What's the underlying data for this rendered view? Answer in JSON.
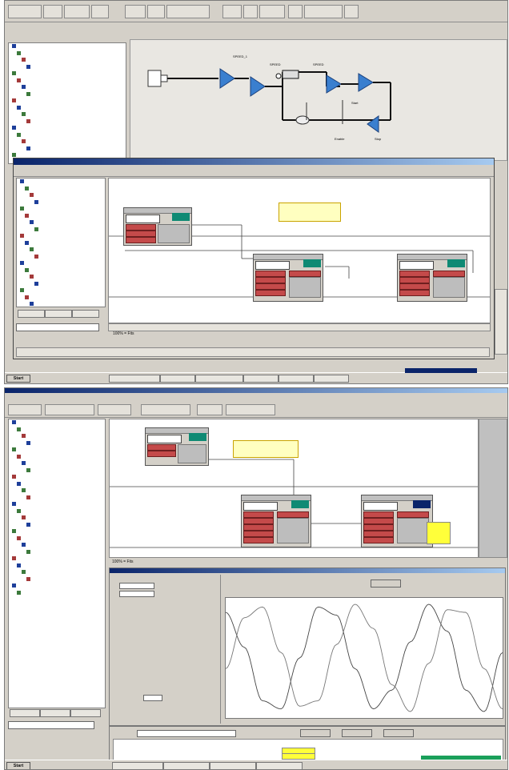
{
  "top": {
    "tree_items": [
      "",
      "",
      "",
      "",
      "",
      "",
      "",
      "",
      "",
      "",
      "",
      "",
      "",
      "",
      "",
      "",
      "",
      "",
      "",
      "",
      ""
    ],
    "diagram_labels": [
      "SPEED_1",
      "SPEED",
      "SPEED",
      "Enable",
      "Start",
      "Stop"
    ],
    "sub_window": {
      "title": "",
      "tree_items": [
        "",
        "",
        "",
        "",
        "",
        "",
        "",
        "",
        "",
        "",
        "",
        "",
        "",
        "",
        "",
        "",
        "",
        "",
        ""
      ],
      "note": "",
      "zoom": "100% = Fits",
      "tabs": [
        "",
        "",
        ""
      ]
    },
    "taskbar": {
      "start": "Start",
      "tasks": [
        "",
        "",
        "",
        "",
        "",
        "",
        ""
      ]
    }
  },
  "bottom": {
    "tree_items": [
      "",
      "",
      "",
      "",
      "",
      "",
      "",
      "",
      "",
      "",
      "",
      "",
      "",
      "",
      "",
      "",
      "",
      "",
      "",
      "",
      "",
      "",
      "",
      "",
      "",
      ""
    ],
    "fb_zoom": "100% = Fits",
    "trace": {
      "title": "",
      "button": "",
      "time_label": "",
      "time_value": ""
    },
    "chart_data": {
      "type": "line",
      "title": "",
      "xlabel": "",
      "ylabel": "",
      "grid": false,
      "series": [
        {
          "values": [
            0.85,
            0.2,
            -0.8,
            -0.95,
            0.0,
            0.95,
            0.8,
            -0.2,
            -0.95,
            -0.6,
            0.3,
            1.0,
            0.5,
            -0.6,
            -1.0,
            0.1
          ]
        },
        {
          "values": [
            -0.2,
            0.75,
            0.95,
            0.1,
            -0.9,
            -0.8,
            0.25,
            1.0,
            0.55,
            -0.5,
            -1.0,
            -0.1,
            0.9,
            0.85,
            -0.2,
            -0.95
          ]
        }
      ]
    },
    "storage_label": "",
    "storage_value": "",
    "buttons": [
      "",
      "",
      ""
    ],
    "table_headers": [
      "",
      "",
      "",
      "",
      "",
      "",
      "",
      ""
    ],
    "taskbar": {
      "start": "Start",
      "tasks": [
        "",
        "",
        "",
        ""
      ]
    }
  },
  "colors": {
    "title_bar": "#0a246a",
    "signal_red": "#c44a4a",
    "teal": "#0f8a74",
    "note_yellow": "#ffffc0",
    "highlight_yellow": "#ffff3a"
  }
}
